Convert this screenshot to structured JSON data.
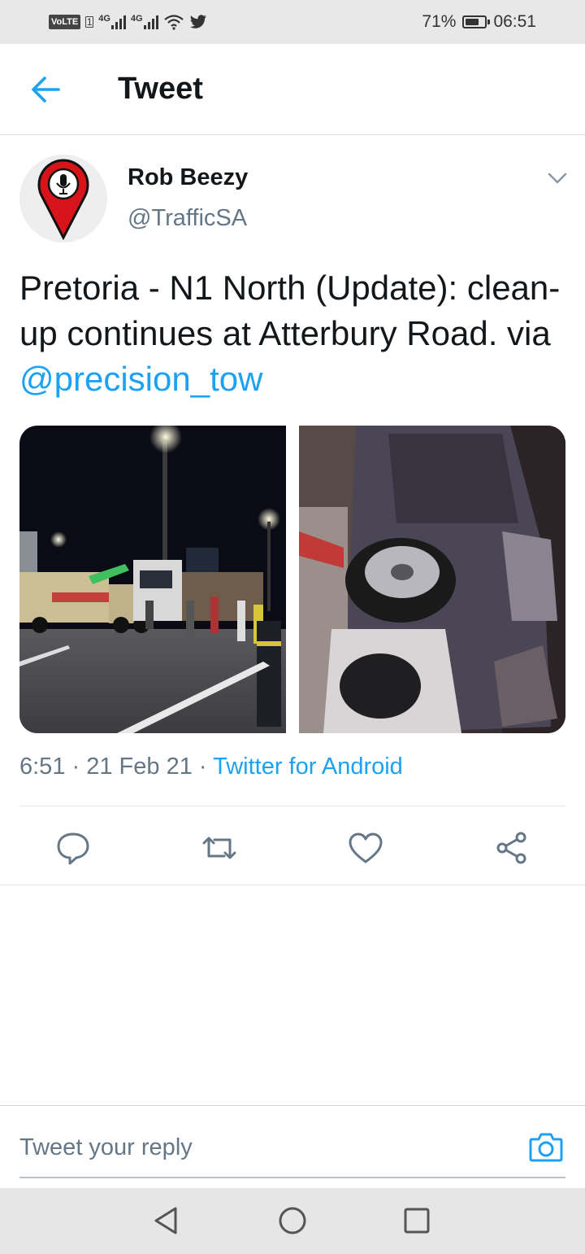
{
  "status_bar": {
    "volte": "VoLTE",
    "sim": "1",
    "network_1": "4G",
    "network_2": "4G",
    "battery": "71%",
    "battery_level": 0.71,
    "time": "06:51"
  },
  "header": {
    "title": "Tweet"
  },
  "tweet": {
    "author_name": "Rob Beezy",
    "author_handle": "@TrafficSA",
    "text_before": "Pretoria - N1 North (Update): clean-up continues at Atterbury Road.  via ",
    "mention": "@precision_tow",
    "time": "6:51",
    "sep1": " · ",
    "date": "21 Feb 21",
    "sep2": " · ",
    "source": "Twitter for Android"
  },
  "reply": {
    "placeholder": "Tweet your reply"
  },
  "colors": {
    "accent": "#1da1f2",
    "text": "#14171a",
    "muted": "#657786"
  }
}
